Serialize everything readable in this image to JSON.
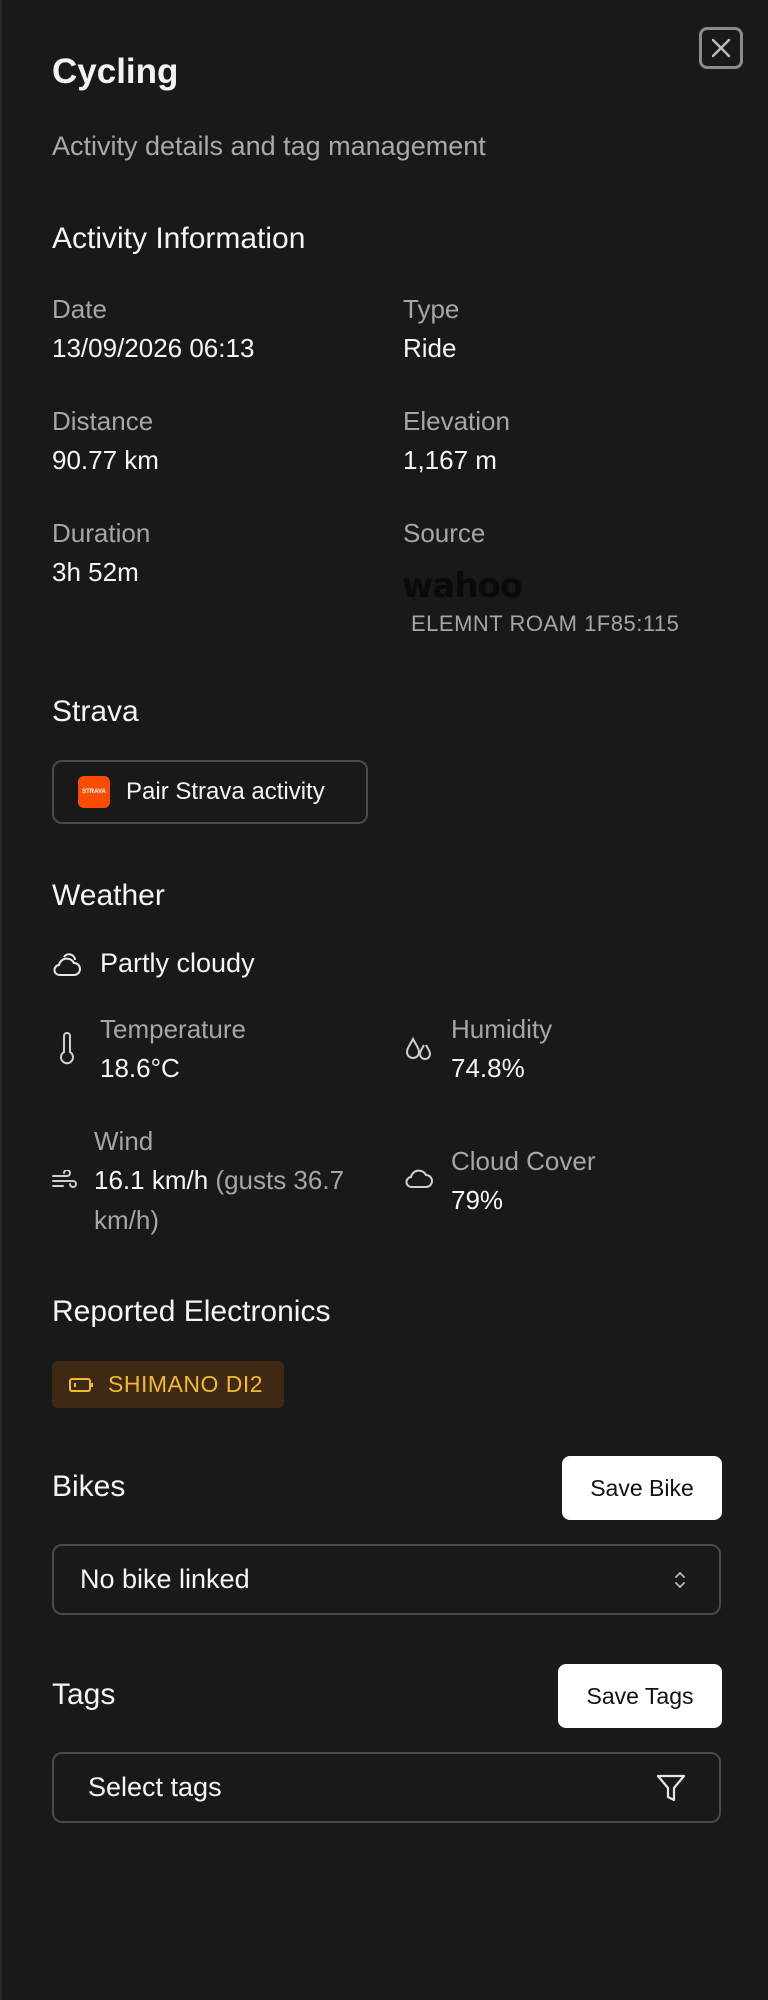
{
  "header": {
    "title": "Cycling",
    "subtitle": "Activity details and tag management",
    "close_icon": "close-icon"
  },
  "activity": {
    "heading": "Activity Information",
    "date_label": "Date",
    "date_value": "13/09/2026 06:13",
    "type_label": "Type",
    "type_value": "Ride",
    "distance_label": "Distance",
    "distance_value": "90.77 km",
    "elevation_label": "Elevation",
    "elevation_value": "1,167 m",
    "duration_label": "Duration",
    "duration_value": "3h 52m",
    "source_label": "Source",
    "source_brand": "wahoo",
    "source_device": "ELEMNT ROAM 1F85:115"
  },
  "strava": {
    "heading": "Strava",
    "logo_text": "STRAVA",
    "button_label": "Pair Strava activity",
    "brand_color": "#fc4c02"
  },
  "weather": {
    "heading": "Weather",
    "condition": "Partly cloudy",
    "temperature_label": "Temperature",
    "temperature_value": "18.6°C",
    "humidity_label": "Humidity",
    "humidity_value": "74.8%",
    "wind_label": "Wind",
    "wind_value": "16.1 km/h",
    "wind_gusts": "(gusts 36.7",
    "wind_gusts_unit": "km/h)",
    "cloud_label": "Cloud Cover",
    "cloud_value": "79%"
  },
  "electronics": {
    "heading": "Reported Electronics",
    "badge": "SHIMANO DI2",
    "badge_color": "#f5b92a"
  },
  "bikes": {
    "heading": "Bikes",
    "save_label": "Save Bike",
    "select_value": "No bike linked"
  },
  "tags": {
    "heading": "Tags",
    "save_label": "Save Tags",
    "select_placeholder": "Select tags"
  }
}
